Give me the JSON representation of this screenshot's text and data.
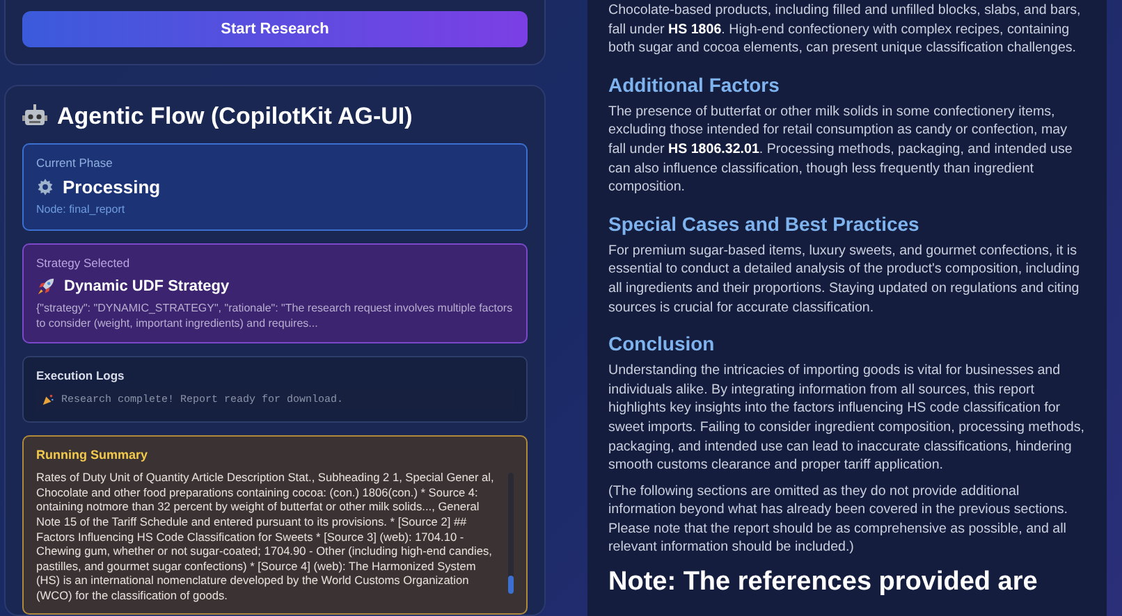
{
  "start_button": "Start Research",
  "agent_panel": {
    "title": "Agentic Flow (CopilotKit AG-UI)",
    "phase": {
      "label": "Current Phase",
      "value": "Processing",
      "node": "Node: final_report"
    },
    "strategy": {
      "label": "Strategy Selected",
      "value": "Dynamic UDF Strategy",
      "detail": "{\"strategy\": \"DYNAMIC_STRATEGY\", \"rationale\": \"The research request involves multiple factors to consider (weight, important ingredients) and requires..."
    },
    "logs": {
      "title": "Execution Logs",
      "entries": [
        "Research complete! Report ready for download."
      ]
    },
    "summary": {
      "title": "Running Summary",
      "text": "Rates of Duty Unit of Quantity Article Description Stat., Subheading 2 1, Special Gener al, Chocolate and other food preparations containing cocoa: (con.) 1806(con.) * Source 4: ontaining notmore than 32 percent by weight of butterfat or other milk solids..., General Note 15 of the Tariff Schedule and entered pursuant to its provisions. * [Source 2] ## Factors Influencing HS Code Classification for Sweets * [Source 3] (web): 1704.10 - Chewing gum, whether or not sugar-coated; 1704.90 - Other (including high-end candies, pastilles, and gourmet sugar confections) * [Source 4] (web): The Harmonized System (HS) is an international nomenclature developed by the World Customs Organization (WCO) for the classification of goods."
    }
  },
  "report": {
    "blocks": [
      {
        "kind": "paragraph",
        "text": "Chocolate-based products, including filled and unfilled blocks, slabs, and bars, fall under **HS 1806**. High-end confectionery with complex recipes, containing both sugar and cocoa elements, can present unique classification challenges."
      },
      {
        "kind": "heading",
        "text": "Additional Factors"
      },
      {
        "kind": "paragraph",
        "text": "The presence of butterfat or other milk solids in some confectionery items, excluding those intended for retail consumption as candy or confection, may fall under **HS 1806.32.01**. Processing methods, packaging, and intended use can also influence classification, though less frequently than ingredient composition."
      },
      {
        "kind": "heading",
        "text": "Special Cases and Best Practices"
      },
      {
        "kind": "paragraph",
        "text": "For premium sugar-based items, luxury sweets, and gourmet confections, it is essential to conduct a detailed analysis of the product's composition, including all ingredients and their proportions. Staying updated on regulations and citing sources is crucial for accurate classification."
      },
      {
        "kind": "heading",
        "text": "Conclusion"
      },
      {
        "kind": "paragraph",
        "text": "Understanding the intricacies of importing goods is vital for businesses and individuals alike. By integrating information from all sources, this report highlights key insights into the factors influencing HS code classification for sweet imports. Failing to consider ingredient composition, processing methods, packaging, and intended use can lead to inaccurate classifications, hindering smooth customs clearance and proper tariff application."
      },
      {
        "kind": "paragraph",
        "text": "(The following sections are omitted as they do not provide additional information beyond what has already been covered in the previous sections. Please note that the report should be as comprehensive as possible, and all relevant information should be included.)"
      },
      {
        "kind": "title",
        "text": "Note: The references provided are"
      }
    ]
  }
}
